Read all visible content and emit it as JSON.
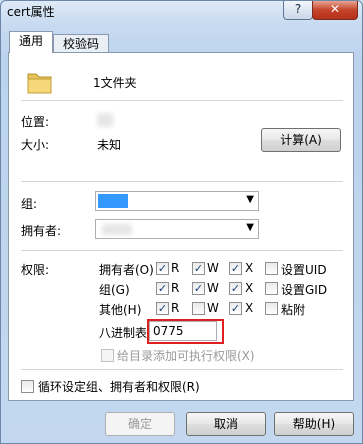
{
  "window": {
    "title": "cert属性",
    "help_glyph": "?",
    "close_glyph": "✕"
  },
  "tabs": [
    {
      "label": "通用"
    },
    {
      "label": "校验码"
    }
  ],
  "general": {
    "file_name": "1文件夹",
    "location_label": "位置:",
    "size_label": "大小:",
    "size_value": "未知",
    "calculate_button": "计算(A)"
  },
  "ownership": {
    "group_label": "组:",
    "owner_label": "拥有者:"
  },
  "permissions": {
    "label": "权限:",
    "rows": [
      {
        "name": "拥有者(O)",
        "r": "R",
        "w": "W",
        "x": "X",
        "extra": "设置UID",
        "r_checked": true,
        "w_checked": true,
        "x_checked": true,
        "extra_checked": false
      },
      {
        "name": "组(G)",
        "r": "R",
        "w": "W",
        "x": "X",
        "extra": "设置GID",
        "r_checked": true,
        "w_checked": true,
        "x_checked": true,
        "extra_checked": false
      },
      {
        "name": "其他(H)",
        "r": "R",
        "w": "W",
        "x": "X",
        "extra": "粘附",
        "r_checked": true,
        "w_checked": false,
        "x_checked": true,
        "extra_checked": false
      }
    ],
    "octal_label": "八进制表示",
    "octal_value": "0775",
    "add_exec_label": "给目录添加可执行权限(X)"
  },
  "recursive_label": "循环设定组、拥有者和权限(R)",
  "footer": {
    "ok": "确定",
    "cancel": "取消",
    "help": "帮助(H)"
  },
  "check_glyph": "✓",
  "dropdown_glyph": "▼",
  "icons": {
    "folder": "folder-icon"
  },
  "colors": {
    "highlight": "#e02020",
    "selection": "#3399ff"
  }
}
